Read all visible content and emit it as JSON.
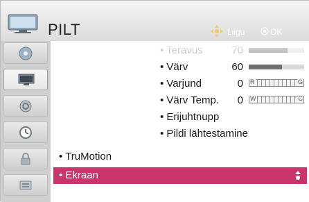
{
  "header": {
    "title": "PILT",
    "hint_move": "Liigu",
    "hint_ok": "OK",
    "icon": "tv-picture-icon"
  },
  "sidebar": {
    "items": [
      {
        "icon": "disc-icon",
        "active": false
      },
      {
        "icon": "picture-icon",
        "active": true
      },
      {
        "icon": "speaker-icon",
        "active": false
      },
      {
        "icon": "clock-icon",
        "active": false
      },
      {
        "icon": "lock-icon",
        "active": false
      },
      {
        "icon": "options-icon",
        "active": false
      }
    ]
  },
  "settings": [
    {
      "label": "• Teravus",
      "value": "70",
      "level": 0.7,
      "kind": "bar",
      "faded": true
    },
    {
      "label": "• Värv",
      "value": "60",
      "level": 0.6,
      "kind": "bar",
      "faded": false
    },
    {
      "label": "• Varjund",
      "value": "0",
      "scale_left": "R",
      "scale_right": "G",
      "kind": "scale",
      "faded": false
    },
    {
      "label": "• Värv Temp.",
      "value": "0",
      "scale_left": "W",
      "scale_right": "C",
      "kind": "scale",
      "faded": false
    },
    {
      "label": "• Erijuhtnupp",
      "kind": "none",
      "faded": false
    },
    {
      "label": "• Pildi lähtestamine",
      "kind": "none",
      "faded": false
    }
  ],
  "main_items": [
    {
      "label": "• TruMotion",
      "selected": false
    },
    {
      "label": "• Ekraan",
      "selected": true
    }
  ],
  "colors": {
    "accent": "#c8356a",
    "bar_fill": "#707070",
    "bar_track": "#d9d9d9"
  }
}
